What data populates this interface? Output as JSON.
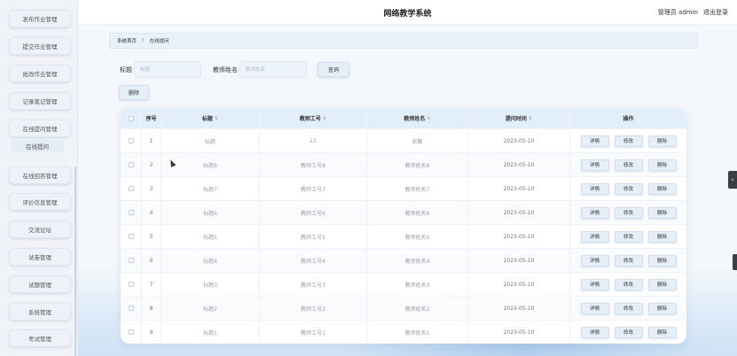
{
  "header": {
    "title": "网络教学系统",
    "admin": "管理员 admin",
    "logout": "退出登录"
  },
  "sidebar": {
    "items": [
      "发布作业管理",
      "提交作业管理",
      "批改作业管理",
      "记录笔记管理",
      "在线提问管理",
      "在线回答管理",
      "评价信息管理",
      "交流论坛",
      "试卷管理",
      "试题管理",
      "系统管理",
      "考试管理"
    ],
    "active_sub": "在线提问"
  },
  "breadcrumb": {
    "home": "系统首页",
    "sep": "⇧",
    "current": "在线提问"
  },
  "search": {
    "title_label": "标题",
    "title_placeholder": "标题",
    "teacher_label": "教师姓名",
    "teacher_placeholder": "教师姓名",
    "query_button": "查询",
    "delete_button": "删除"
  },
  "table": {
    "columns": {
      "idx": "序号",
      "title": "标题",
      "teacher_no": "教师工号",
      "teacher_name": "教师姓名",
      "time": "提问时间",
      "ops": "操作"
    },
    "sort_icon": "⇅",
    "actions": {
      "detail": "详情",
      "edit": "修改",
      "delete": "删除"
    },
    "rows": [
      {
        "idx": "1",
        "title": "标题",
        "teacher_no": "22",
        "teacher_name": "张飘",
        "time": "2023-05-10"
      },
      {
        "idx": "2",
        "title": "标题8",
        "teacher_no": "教师工号8",
        "teacher_name": "教师姓名8",
        "time": "2023-05-10"
      },
      {
        "idx": "3",
        "title": "标题7",
        "teacher_no": "教师工号7",
        "teacher_name": "教师姓名7",
        "time": "2023-05-10"
      },
      {
        "idx": "4",
        "title": "标题6",
        "teacher_no": "教师工号6",
        "teacher_name": "教师姓名6",
        "time": "2023-05-10"
      },
      {
        "idx": "5",
        "title": "标题5",
        "teacher_no": "教师工号5",
        "teacher_name": "教师姓名5",
        "time": "2023-05-10"
      },
      {
        "idx": "6",
        "title": "标题4",
        "teacher_no": "教师工号4",
        "teacher_name": "教师姓名4",
        "time": "2023-05-10"
      },
      {
        "idx": "7",
        "title": "标题3",
        "teacher_no": "教师工号3",
        "teacher_name": "教师姓名3",
        "time": "2023-05-10"
      },
      {
        "idx": "8",
        "title": "标题2",
        "teacher_no": "教师工号2",
        "teacher_name": "教师姓名2",
        "time": "2023-05-10"
      },
      {
        "idx": "9",
        "title": "标题1",
        "teacher_no": "教师工号1",
        "teacher_name": "教师姓名1",
        "time": "2023-05-10"
      }
    ]
  },
  "edge_tab_icon": "‹",
  "colors": {
    "accent": "#e3eefb",
    "button_bg": "#e6eef8",
    "page_bg": "#f4f7fb"
  }
}
